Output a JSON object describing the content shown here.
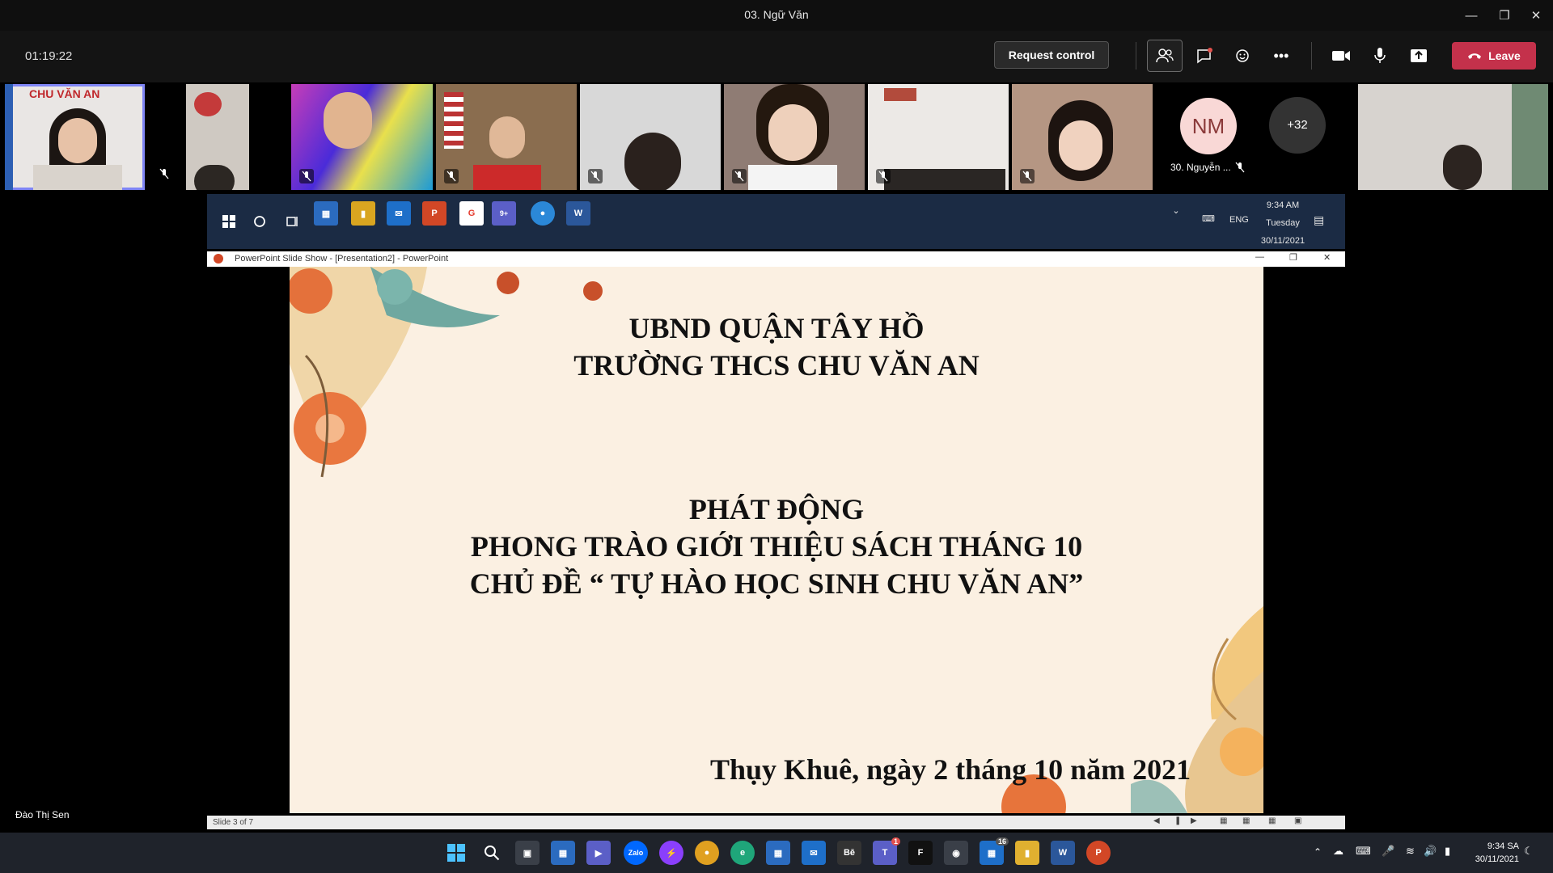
{
  "window": {
    "title": "03. Ngữ Văn"
  },
  "toolbar": {
    "timer": "01:19:22",
    "request_control": "Request control",
    "leave": "Leave"
  },
  "participants": {
    "tile1_label": "CHU VĂN AN",
    "avatar_initials": "NM",
    "avatar_name": "30. Nguyễn ...",
    "more_count": "+32"
  },
  "shared_taskbar": {
    "time": "9:34 AM",
    "day": "Tuesday",
    "date": "30/11/2021",
    "lang": "ENG",
    "teams_badge": "9+"
  },
  "ppt": {
    "window_title": "PowerPoint Slide Show - [Presentation2] - PowerPoint",
    "status": "Slide 3 of 7"
  },
  "slide": {
    "line1": "UBND QUẬN TÂY HỒ",
    "line2": "TRƯỜNG THCS CHU VĂN AN",
    "line3": "PHÁT ĐỘNG",
    "line4": "PHONG TRÀO GIỚI THIỆU SÁCH THÁNG 10",
    "line5": "CHỦ ĐỀ “ TỰ HÀO HỌC SINH CHU VĂN AN”",
    "footer": "Thụy Khuê, ngày 2 tháng 10 năm 2021"
  },
  "presenter": {
    "name": "Đào Thị Sen"
  },
  "taskbar": {
    "time": "9:34 SA",
    "date": "30/11/2021",
    "teams_badge": "1",
    "app_badge": "16"
  },
  "colors": {
    "leave": "#c4314b",
    "accent": "#7f85f5",
    "slide_bg": "#fbf0e2"
  }
}
